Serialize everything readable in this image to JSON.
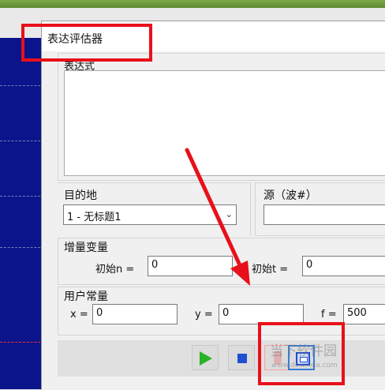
{
  "dialog": {
    "title": "表达评估器"
  },
  "expression": {
    "label": "表达式",
    "value": ""
  },
  "destination": {
    "label": "目的地",
    "selected": "1 - 无标题1"
  },
  "source": {
    "label": "源（波#）",
    "value": ""
  },
  "increment": {
    "label": "增量变量",
    "init_n_label": "初始n =",
    "init_n_value": "0",
    "init_t_label": "初始t =",
    "init_t_value": "0"
  },
  "constants": {
    "label": "用户常量",
    "x_label": "x =",
    "x_value": "0",
    "y_label": "y =",
    "y_value": "0",
    "f_label": "f =",
    "f_value": "500"
  },
  "toolbar": {
    "play_icon": "play-icon",
    "stop_icon": "stop-icon",
    "evaluate_icon": "calculator-icon"
  },
  "watermark": {
    "text": "当下软件园",
    "url": "www.downxia.com"
  },
  "colors": {
    "annotation_red": "#e8101a",
    "plot_bg": "#0b148a",
    "play_green": "#28b328",
    "accent_blue": "#1f4fd0"
  }
}
